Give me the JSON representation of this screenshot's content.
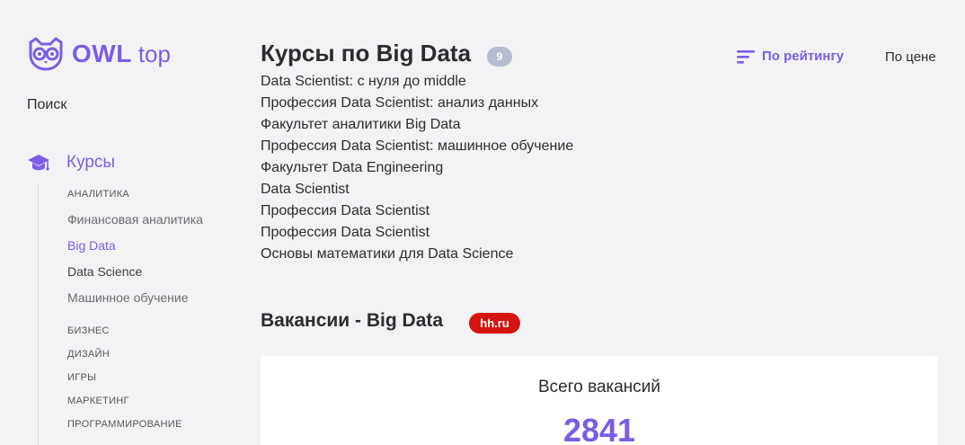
{
  "colors": {
    "accent": "#7c5ce6",
    "text": "#2b2b33",
    "background": "#f3f3f5",
    "hh_red": "#d4150f",
    "badge_gray": "#b5bdd0"
  },
  "logo": {
    "brand": "OWL",
    "suffix": "top",
    "icon": "owl-icon"
  },
  "sidebar": {
    "search": "Поиск",
    "courses_icon": "graduation-cap-icon",
    "courses_label": "Курсы",
    "items": [
      {
        "label": "Аналитика",
        "kind": "category"
      },
      {
        "label": "Финансовая аналитика",
        "kind": "sub"
      },
      {
        "label": "Big Data",
        "kind": "active"
      },
      {
        "label": "Data Science",
        "kind": "sub-dark"
      },
      {
        "label": "Машинное обучение",
        "kind": "sub"
      },
      {
        "label": "Бизнес",
        "kind": "category"
      },
      {
        "label": "Дизайн",
        "kind": "category"
      },
      {
        "label": "Игры",
        "kind": "category"
      },
      {
        "label": "Маркетинг",
        "kind": "category"
      },
      {
        "label": "Программирование",
        "kind": "category"
      }
    ]
  },
  "main": {
    "title": "Курсы по Big Data",
    "count": "9",
    "sort": {
      "rating_label": "По рейтингу",
      "rating_icon": "sort-lines-icon",
      "price_label": "По цене"
    },
    "courses": [
      "Data Scientist: с нуля до middle",
      "Профессия Data Scientist: анализ данных",
      "Факультет аналитики Big Data",
      "Профессия Data Scientist: машинное обучение",
      "Факультет Data Engineering",
      "Data Scientist",
      "Профессия Data Scientist",
      "Профессия Data Scientist",
      "Основы математики для Data Science"
    ]
  },
  "vacancies": {
    "title": "Вакансии - Big Data",
    "source_badge": "hh.ru",
    "total_label": "Всего вакансий",
    "total_value": "2841"
  }
}
